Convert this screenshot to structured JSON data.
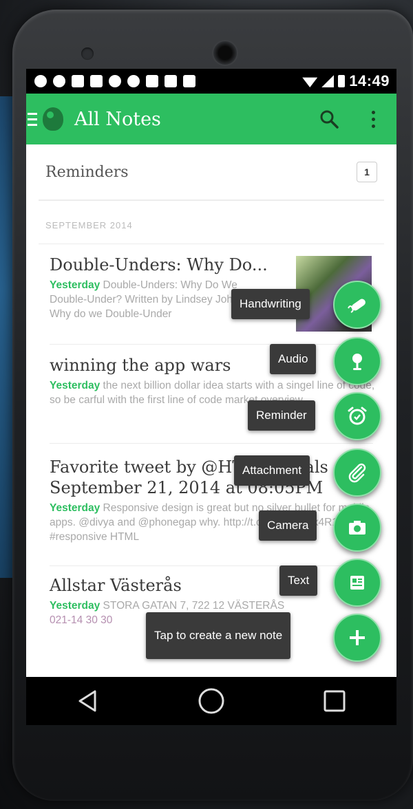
{
  "status_bar": {
    "time": "14:49"
  },
  "app_bar": {
    "title": "All Notes"
  },
  "reminders": {
    "label": "Reminders",
    "count": "1"
  },
  "section": {
    "header": "SEPTEMBER 2014"
  },
  "notes": [
    {
      "title": "Double-Unders: Why Do...",
      "date": "Yesterday",
      "snippet": " Double-Unders: Why Do We Double-Under?  Written by Lindsey Johnson   Why do we Double-Under"
    },
    {
      "title": "winning the app wars",
      "date": "Yesterday",
      "snippet": " the next billion dollar idea starts with a singel line of code, so be carful with the first line of code market overview"
    },
    {
      "title": "Favorite tweet by @HTML5Deals September 21, 2014 at 08:05PM",
      "date": "Yesterday",
      "snippet": " Responsive design is great but no silver bullet for mobile apps. @divya and @phonegap why.  http://t.co/npCWEdx4R1 #responsive  HTML"
    },
    {
      "title": "Allstar Västerås",
      "date": "Yesterday",
      "snippet": " STORA GATAN 7, 722 12 VÄSTERÅS",
      "extra": "021-14 30 30"
    }
  ],
  "fab_menu": [
    {
      "label": "Handwriting",
      "icon": "handwriting-icon"
    },
    {
      "label": "Audio",
      "icon": "microphone-icon"
    },
    {
      "label": "Reminder",
      "icon": "alarm-clock-icon"
    },
    {
      "label": "Attachment",
      "icon": "paperclip-icon"
    },
    {
      "label": "Camera",
      "icon": "camera-icon"
    },
    {
      "label": "Text",
      "icon": "text-note-icon"
    },
    {
      "label": "Tap to create a new note",
      "icon": "plus-icon"
    }
  ],
  "colors": {
    "accent": "#2dbe60",
    "date_green": "#2dbe60",
    "label_bg": "#3a3a3a"
  }
}
